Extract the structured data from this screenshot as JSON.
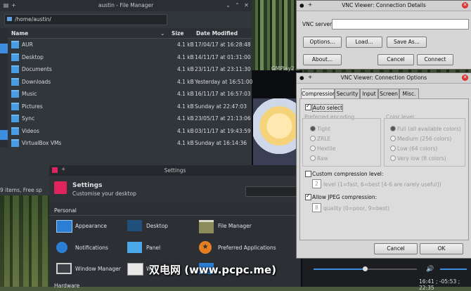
{
  "file_manager": {
    "title": "austin - File Manager",
    "path": "/home/austin/",
    "columns": [
      "Name",
      "Size",
      "Date Modified"
    ],
    "rows": [
      {
        "name": "AUR",
        "size": "4.1 kB",
        "date": "17/04/17 at 16:28:48"
      },
      {
        "name": "Desktop",
        "size": "4.1 kB",
        "date": "14/11/17 at 01:31:00"
      },
      {
        "name": "Documents",
        "size": "4.1 kB",
        "date": "23/11/17 at 23:11:30"
      },
      {
        "name": "Downloads",
        "size": "4.1 kB",
        "date": "Yesterday at 16:51:00"
      },
      {
        "name": "Music",
        "size": "4.1 kB",
        "date": "16/11/17 at 16:57:03"
      },
      {
        "name": "Pictures",
        "size": "4.1 kB",
        "date": "Sunday at 22:47:03"
      },
      {
        "name": "Sync",
        "size": "4.1 kB",
        "date": "23/05/17 at 21:13:06"
      },
      {
        "name": "Videos",
        "size": "4.1 kB",
        "date": "03/11/17 at 19:43:59"
      },
      {
        "name": "VirtualBox VMs",
        "size": "4.1 kB",
        "date": "Sunday at 16:14:36"
      }
    ],
    "status": "9 items, Free sp"
  },
  "settings": {
    "window_title": "Settings",
    "title": "Settings",
    "subtitle": "Customise your desktop",
    "section_personal": "Personal",
    "section_hardware": "Hardware",
    "items": [
      {
        "label": "Appearance"
      },
      {
        "label": "Desktop"
      },
      {
        "label": "File Manager"
      },
      {
        "label": "Notifications"
      },
      {
        "label": "Panel"
      },
      {
        "label": "Preferred Applications"
      },
      {
        "label": "Window Manager"
      },
      {
        "label": "W"
      },
      {
        "label": ""
      }
    ]
  },
  "media": {
    "label": "GMPlay2",
    "time": "16:41 ; -05:53 ; 22:35"
  },
  "vnc_details": {
    "title": "VNC Viewer: Connection Details",
    "server_label": "VNC server:",
    "server_value": "",
    "options": "Options...",
    "load": "Load...",
    "save_as": "Save As...",
    "about": "About...",
    "cancel": "Cancel",
    "connect": "Connect"
  },
  "vnc_options": {
    "title": "VNC Viewer: Connection Options",
    "tabs": [
      "Compression",
      "Security",
      "Input",
      "Screen",
      "Misc."
    ],
    "auto_select": "Auto select",
    "preferred_encoding": "Preferred encoding",
    "encodings": [
      "Tight",
      "ZRLE",
      "Hextile",
      "Raw"
    ],
    "color_level": "Color level",
    "colors": [
      "Full (all available colors)",
      "Medium (256 colors)",
      "Low (64 colors)",
      "Very low (8 colors)"
    ],
    "custom_compression": "Custom compression level:",
    "compression_value": "2",
    "compression_hint": "level (1=fast, 6=best [4-6 are rarely useful])",
    "allow_jpeg": "Allow JPEG compression:",
    "jpeg_value": "8",
    "jpeg_hint": "quality (0=poor, 9=best)",
    "cancel": "Cancel",
    "ok": "OK"
  },
  "watermark": "双电网 (www.pcpc.me)"
}
